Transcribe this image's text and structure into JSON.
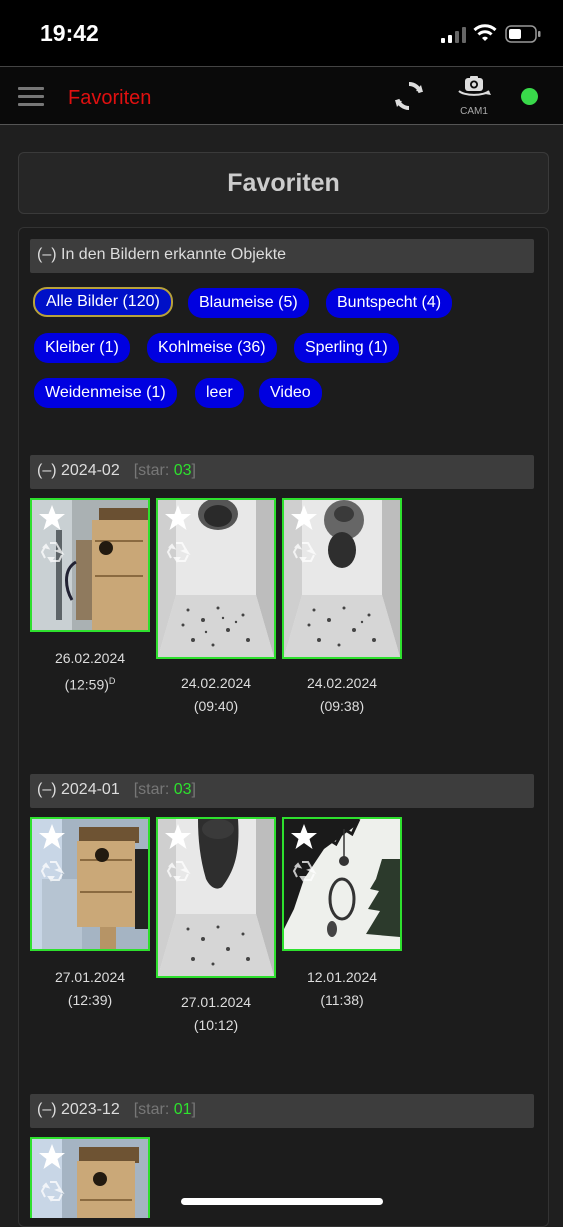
{
  "status": {
    "time": "19:42"
  },
  "header": {
    "title": "Favoriten",
    "cam_label": "CAM1",
    "connection_color": "#39d94a"
  },
  "page_title": "Favoriten",
  "objects": {
    "toggle_label": "(–) In den Bildern erkannte Objekte",
    "chips": [
      {
        "label": "Alle Bilder (120)",
        "active": true
      },
      {
        "label": "Blaumeise (5)"
      },
      {
        "label": "Buntspecht (4)"
      },
      {
        "label": "Kleiber (1)"
      },
      {
        "label": "Kohlmeise (36)"
      },
      {
        "label": "Sperling (1)"
      },
      {
        "label": "Weidenmeise (1)"
      },
      {
        "label": "leer"
      },
      {
        "label": "Video"
      }
    ]
  },
  "groups": [
    {
      "label": "(–) 2024-02",
      "star_label": "star:",
      "star_count": "03",
      "images": [
        {
          "date": "26.02.2024",
          "time": "(12:59)",
          "mark": "D",
          "scene": "birdhouse"
        },
        {
          "date": "24.02.2024",
          "time": "(09:40)",
          "scene": "box-inside"
        },
        {
          "date": "24.02.2024",
          "time": "(09:38)",
          "scene": "box-bird"
        }
      ]
    },
    {
      "label": "(–) 2024-01",
      "star_label": "star:",
      "star_count": "03",
      "images": [
        {
          "date": "27.01.2024",
          "time": "(12:39)",
          "scene": "birdhouse"
        },
        {
          "date": "27.01.2024",
          "time": "(10:12)",
          "scene": "box-bird"
        },
        {
          "date": "12.01.2024",
          "time": "(11:38)",
          "scene": "feeder"
        }
      ]
    },
    {
      "label": "(–) 2023-12",
      "star_label": "star:",
      "star_count": "01",
      "images": [
        {
          "scene": "birdhouse"
        }
      ]
    }
  ]
}
